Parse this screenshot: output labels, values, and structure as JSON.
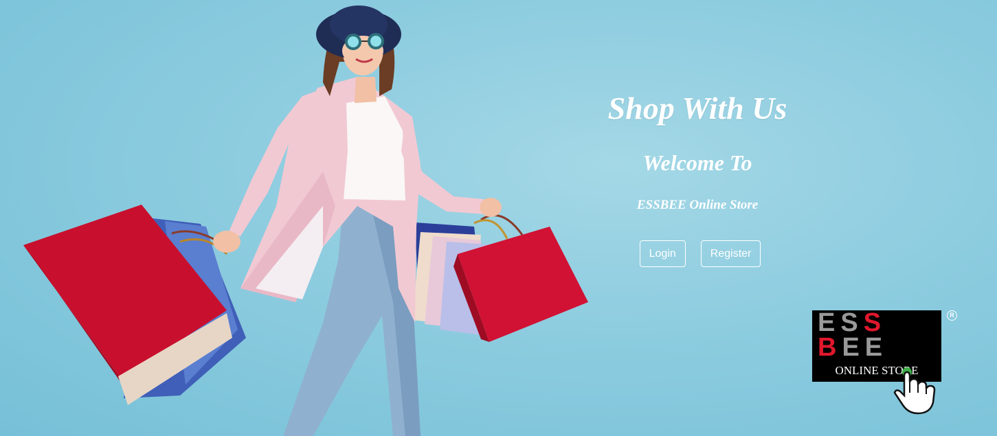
{
  "hero": {
    "headline": "Shop With Us",
    "subheadline": "Welcome To",
    "store_name": "ESSBEE Online Store"
  },
  "actions": {
    "login_label": "Login",
    "register_label": "Register"
  },
  "logo": {
    "line1_gray": "ES",
    "line1_red": "S",
    "line2_red": "B",
    "line2_gray": "EE",
    "tagline": "ONLINE STORE",
    "registered_symbol": "R"
  },
  "icons": {
    "hero_image": "shopping-woman-illustration",
    "logo_pointer": "hand-pointer-icon",
    "registered": "registered-trademark-icon"
  },
  "colors": {
    "background": "#8fcde0",
    "logo_background": "#000000",
    "logo_gray": "#9a9a9a",
    "logo_red": "#e0182d",
    "text": "#ffffff"
  }
}
